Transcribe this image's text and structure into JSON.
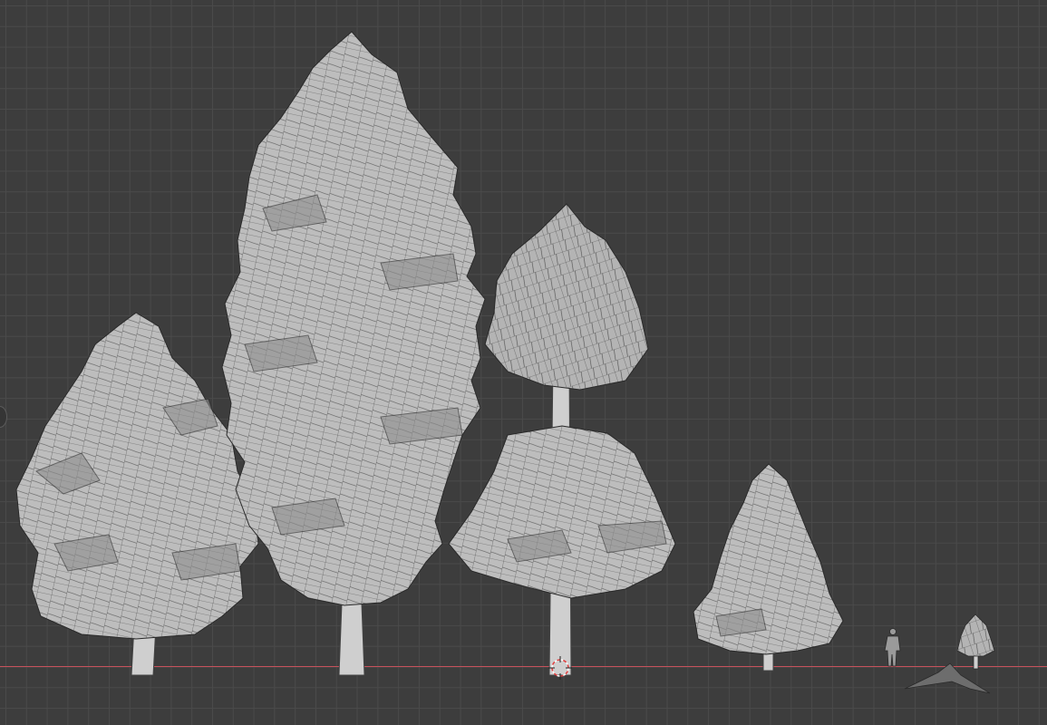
{
  "viewport": {
    "view": "orthographic-front",
    "colors": {
      "background": "#3d3d3d",
      "grid_line": "#4a4a4a",
      "x_axis": "#c6525b",
      "mesh_fill": "#bdbdbd",
      "mesh_shade": "#8e8e8e",
      "wire": "#2e2e2e",
      "trunk": "#cfcfcf",
      "cursor_red": "#e04040",
      "cursor_white": "#ffffff"
    }
  },
  "objects": [
    {
      "name": "pine-tree-1",
      "kind": "conifer"
    },
    {
      "name": "pine-tree-2",
      "kind": "conifer-tall"
    },
    {
      "name": "pine-tree-3",
      "kind": "conifer-sparse"
    },
    {
      "name": "pine-tree-4",
      "kind": "conifer-small"
    },
    {
      "name": "human-reference",
      "kind": "scale-figure"
    },
    {
      "name": "pine-tree-tiny",
      "kind": "conifer-tiny"
    },
    {
      "name": "ground-piece",
      "kind": "mesh-fragment"
    }
  ],
  "icons": {
    "cursor": "3d-cursor-icon",
    "gizmo": "navigation-gizmo-icon"
  }
}
